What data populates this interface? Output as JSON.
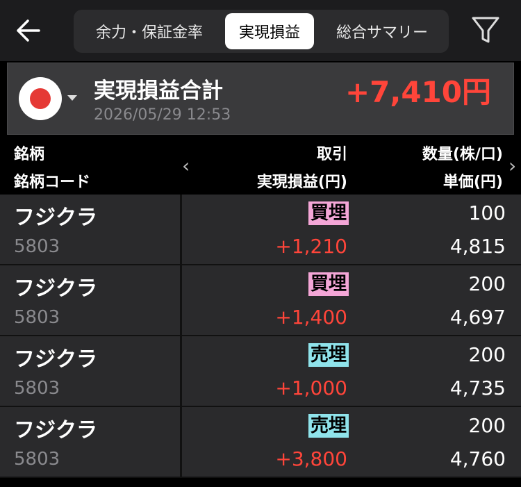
{
  "header": {
    "tabs": [
      {
        "label": "余力・保証金率"
      },
      {
        "label": "実現損益"
      },
      {
        "label": "総合サマリー"
      }
    ]
  },
  "summary": {
    "title": "実現損益合計",
    "datetime": "2026/05/29 12:53",
    "total": "+7,410円"
  },
  "table": {
    "headers": {
      "col1_top": "銘柄",
      "col1_bottom": "銘柄コード",
      "col2_top": "取引",
      "col2_bottom": "実現損益(円)",
      "col3_top": "数量(株/口)",
      "col3_bottom": "単価(円)",
      "prev_arrow": "‹",
      "next_arrow": "›"
    },
    "rows": [
      {
        "name": "フジクラ",
        "code": "5803",
        "trade": "買埋",
        "pl": "+1,210",
        "qty": "100",
        "price": "4,815"
      },
      {
        "name": "フジクラ",
        "code": "5803",
        "trade": "買埋",
        "pl": "+1,400",
        "qty": "200",
        "price": "4,697"
      },
      {
        "name": "フジクラ",
        "code": "5803",
        "trade": "売埋",
        "pl": "+1,000",
        "qty": "200",
        "price": "4,735"
      },
      {
        "name": "フジクラ",
        "code": "5803",
        "trade": "売埋",
        "pl": "+3,800",
        "qty": "200",
        "price": "4,760"
      }
    ]
  },
  "colors": {
    "profit": "#ff453a",
    "buy_badge": "#f4a6d7",
    "sell_badge": "#8fe3eb",
    "active_tab": "#ffffff"
  }
}
